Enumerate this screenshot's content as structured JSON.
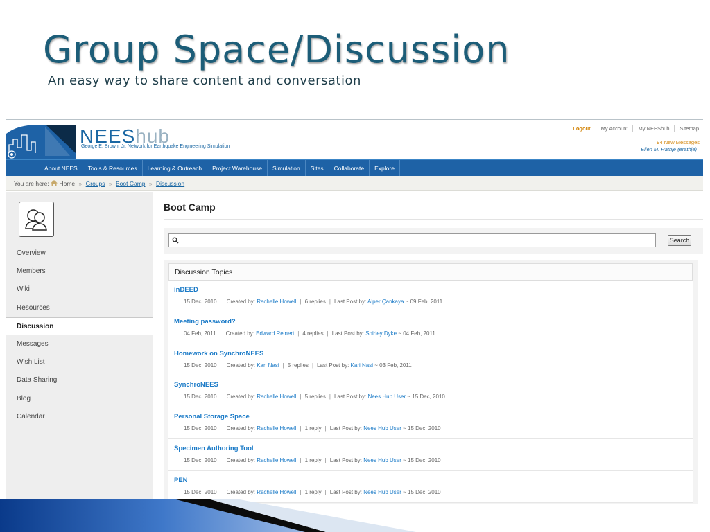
{
  "slide": {
    "title": "Group Space/Discussion",
    "subtitle": "An easy way to share content and conversation"
  },
  "header": {
    "brand_main": "NEES",
    "brand_hub": "hub",
    "tagline": "George E. Brown, Jr. Network for Earthquake Engineering Simulation",
    "top_links": [
      "Logout",
      "My Account",
      "My NEEShub",
      "Sitemap"
    ],
    "new_messages": "94 New Messages",
    "user": "Ellen M. Rathje (erathje)"
  },
  "nav": [
    "About NEES",
    "Tools & Resources",
    "Learning & Outreach",
    "Project Warehouse",
    "Simulation",
    "Sites",
    "Collaborate",
    "Explore"
  ],
  "breadcrumb": {
    "prefix": "You are here:",
    "home": "Home",
    "groups": "Groups",
    "boot_camp": "Boot Camp",
    "discussion": "Discussion",
    "separator": "»"
  },
  "sidebar": {
    "items": [
      "Overview",
      "Members",
      "Wiki",
      "Resources",
      "Discussion",
      "Messages",
      "Wish List",
      "Data Sharing",
      "Blog",
      "Calendar"
    ],
    "active": "Discussion"
  },
  "main": {
    "title": "Boot Camp",
    "search_button": "Search",
    "topics_header": "Discussion Topics",
    "created_by_label": "Created by:",
    "last_post_label": "Last Post by:"
  },
  "topics": [
    {
      "title": "inDEED",
      "date": "15 Dec, 2010",
      "author": "Rachelle Howell",
      "replies": "6 replies",
      "last_by": "Alper Çankaya",
      "last_date": "~ 09 Feb, 2011"
    },
    {
      "title": "Meeting password?",
      "date": "04 Feb, 2011",
      "author": "Edward Reinert",
      "replies": "4 replies",
      "last_by": "Shirley Dyke",
      "last_date": "~ 04 Feb, 2011"
    },
    {
      "title": "Homework on SynchroNEES",
      "date": "15 Dec, 2010",
      "author": "Kari Nasi",
      "replies": "5 replies",
      "last_by": "Kari Nasi",
      "last_date": "~ 03 Feb, 2011"
    },
    {
      "title": "SynchroNEES",
      "date": "15 Dec, 2010",
      "author": "Rachelle Howell",
      "replies": "5 replies",
      "last_by": "Nees Hub User",
      "last_date": "~ 15 Dec, 2010"
    },
    {
      "title": "Personal Storage Space",
      "date": "15 Dec, 2010",
      "author": "Rachelle Howell",
      "replies": "1 reply",
      "last_by": "Nees Hub User",
      "last_date": "~ 15 Dec, 2010"
    },
    {
      "title": "Specimen Authoring Tool",
      "date": "15 Dec, 2010",
      "author": "Rachelle Howell",
      "replies": "1 reply",
      "last_by": "Nees Hub User",
      "last_date": "~ 15 Dec, 2010"
    },
    {
      "title": "PEN",
      "date": "15 Dec, 2010",
      "author": "Rachelle Howell",
      "replies": "1 reply",
      "last_by": "Nees Hub User",
      "last_date": "~ 15 Dec, 2010"
    }
  ],
  "colors": {
    "title": "#1c5d78",
    "nav_bg": "#1e62a6",
    "link": "#1a7ac7",
    "accent_orange": "#d3860c"
  },
  "icons": {
    "home": "home-icon",
    "search": "search-icon",
    "group": "group-avatar-icon"
  }
}
